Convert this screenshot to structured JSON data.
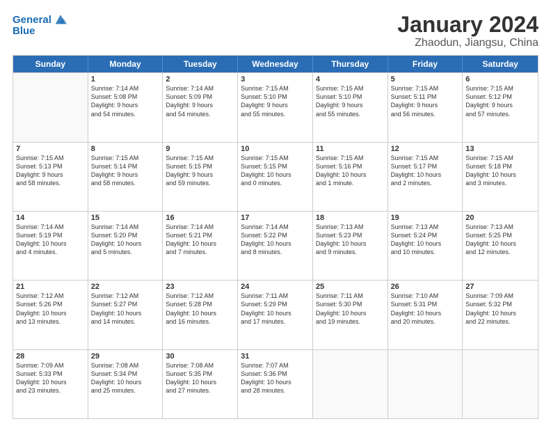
{
  "header": {
    "logo_line1": "General",
    "logo_line2": "Blue",
    "title": "January 2024",
    "subtitle": "Zhaodun, Jiangsu, China"
  },
  "days": [
    "Sunday",
    "Monday",
    "Tuesday",
    "Wednesday",
    "Thursday",
    "Friday",
    "Saturday"
  ],
  "weeks": [
    [
      {
        "day": "",
        "info": ""
      },
      {
        "day": "1",
        "info": "Sunrise: 7:14 AM\nSunset: 5:08 PM\nDaylight: 9 hours\nand 54 minutes."
      },
      {
        "day": "2",
        "info": "Sunrise: 7:14 AM\nSunset: 5:09 PM\nDaylight: 9 hours\nand 54 minutes."
      },
      {
        "day": "3",
        "info": "Sunrise: 7:15 AM\nSunset: 5:10 PM\nDaylight: 9 hours\nand 55 minutes."
      },
      {
        "day": "4",
        "info": "Sunrise: 7:15 AM\nSunset: 5:10 PM\nDaylight: 9 hours\nand 55 minutes."
      },
      {
        "day": "5",
        "info": "Sunrise: 7:15 AM\nSunset: 5:11 PM\nDaylight: 9 hours\nand 56 minutes."
      },
      {
        "day": "6",
        "info": "Sunrise: 7:15 AM\nSunset: 5:12 PM\nDaylight: 9 hours\nand 57 minutes."
      }
    ],
    [
      {
        "day": "7",
        "info": "Sunrise: 7:15 AM\nSunset: 5:13 PM\nDaylight: 9 hours\nand 58 minutes."
      },
      {
        "day": "8",
        "info": "Sunrise: 7:15 AM\nSunset: 5:14 PM\nDaylight: 9 hours\nand 58 minutes."
      },
      {
        "day": "9",
        "info": "Sunrise: 7:15 AM\nSunset: 5:15 PM\nDaylight: 9 hours\nand 59 minutes."
      },
      {
        "day": "10",
        "info": "Sunrise: 7:15 AM\nSunset: 5:15 PM\nDaylight: 10 hours\nand 0 minutes."
      },
      {
        "day": "11",
        "info": "Sunrise: 7:15 AM\nSunset: 5:16 PM\nDaylight: 10 hours\nand 1 minute."
      },
      {
        "day": "12",
        "info": "Sunrise: 7:15 AM\nSunset: 5:17 PM\nDaylight: 10 hours\nand 2 minutes."
      },
      {
        "day": "13",
        "info": "Sunrise: 7:15 AM\nSunset: 5:18 PM\nDaylight: 10 hours\nand 3 minutes."
      }
    ],
    [
      {
        "day": "14",
        "info": "Sunrise: 7:14 AM\nSunset: 5:19 PM\nDaylight: 10 hours\nand 4 minutes."
      },
      {
        "day": "15",
        "info": "Sunrise: 7:14 AM\nSunset: 5:20 PM\nDaylight: 10 hours\nand 5 minutes."
      },
      {
        "day": "16",
        "info": "Sunrise: 7:14 AM\nSunset: 5:21 PM\nDaylight: 10 hours\nand 7 minutes."
      },
      {
        "day": "17",
        "info": "Sunrise: 7:14 AM\nSunset: 5:22 PM\nDaylight: 10 hours\nand 8 minutes."
      },
      {
        "day": "18",
        "info": "Sunrise: 7:13 AM\nSunset: 5:23 PM\nDaylight: 10 hours\nand 9 minutes."
      },
      {
        "day": "19",
        "info": "Sunrise: 7:13 AM\nSunset: 5:24 PM\nDaylight: 10 hours\nand 10 minutes."
      },
      {
        "day": "20",
        "info": "Sunrise: 7:13 AM\nSunset: 5:25 PM\nDaylight: 10 hours\nand 12 minutes."
      }
    ],
    [
      {
        "day": "21",
        "info": "Sunrise: 7:12 AM\nSunset: 5:26 PM\nDaylight: 10 hours\nand 13 minutes."
      },
      {
        "day": "22",
        "info": "Sunrise: 7:12 AM\nSunset: 5:27 PM\nDaylight: 10 hours\nand 14 minutes."
      },
      {
        "day": "23",
        "info": "Sunrise: 7:12 AM\nSunset: 5:28 PM\nDaylight: 10 hours\nand 16 minutes."
      },
      {
        "day": "24",
        "info": "Sunrise: 7:11 AM\nSunset: 5:29 PM\nDaylight: 10 hours\nand 17 minutes."
      },
      {
        "day": "25",
        "info": "Sunrise: 7:11 AM\nSunset: 5:30 PM\nDaylight: 10 hours\nand 19 minutes."
      },
      {
        "day": "26",
        "info": "Sunrise: 7:10 AM\nSunset: 5:31 PM\nDaylight: 10 hours\nand 20 minutes."
      },
      {
        "day": "27",
        "info": "Sunrise: 7:09 AM\nSunset: 5:32 PM\nDaylight: 10 hours\nand 22 minutes."
      }
    ],
    [
      {
        "day": "28",
        "info": "Sunrise: 7:09 AM\nSunset: 5:33 PM\nDaylight: 10 hours\nand 23 minutes."
      },
      {
        "day": "29",
        "info": "Sunrise: 7:08 AM\nSunset: 5:34 PM\nDaylight: 10 hours\nand 25 minutes."
      },
      {
        "day": "30",
        "info": "Sunrise: 7:08 AM\nSunset: 5:35 PM\nDaylight: 10 hours\nand 27 minutes."
      },
      {
        "day": "31",
        "info": "Sunrise: 7:07 AM\nSunset: 5:36 PM\nDaylight: 10 hours\nand 28 minutes."
      },
      {
        "day": "",
        "info": ""
      },
      {
        "day": "",
        "info": ""
      },
      {
        "day": "",
        "info": ""
      }
    ]
  ]
}
